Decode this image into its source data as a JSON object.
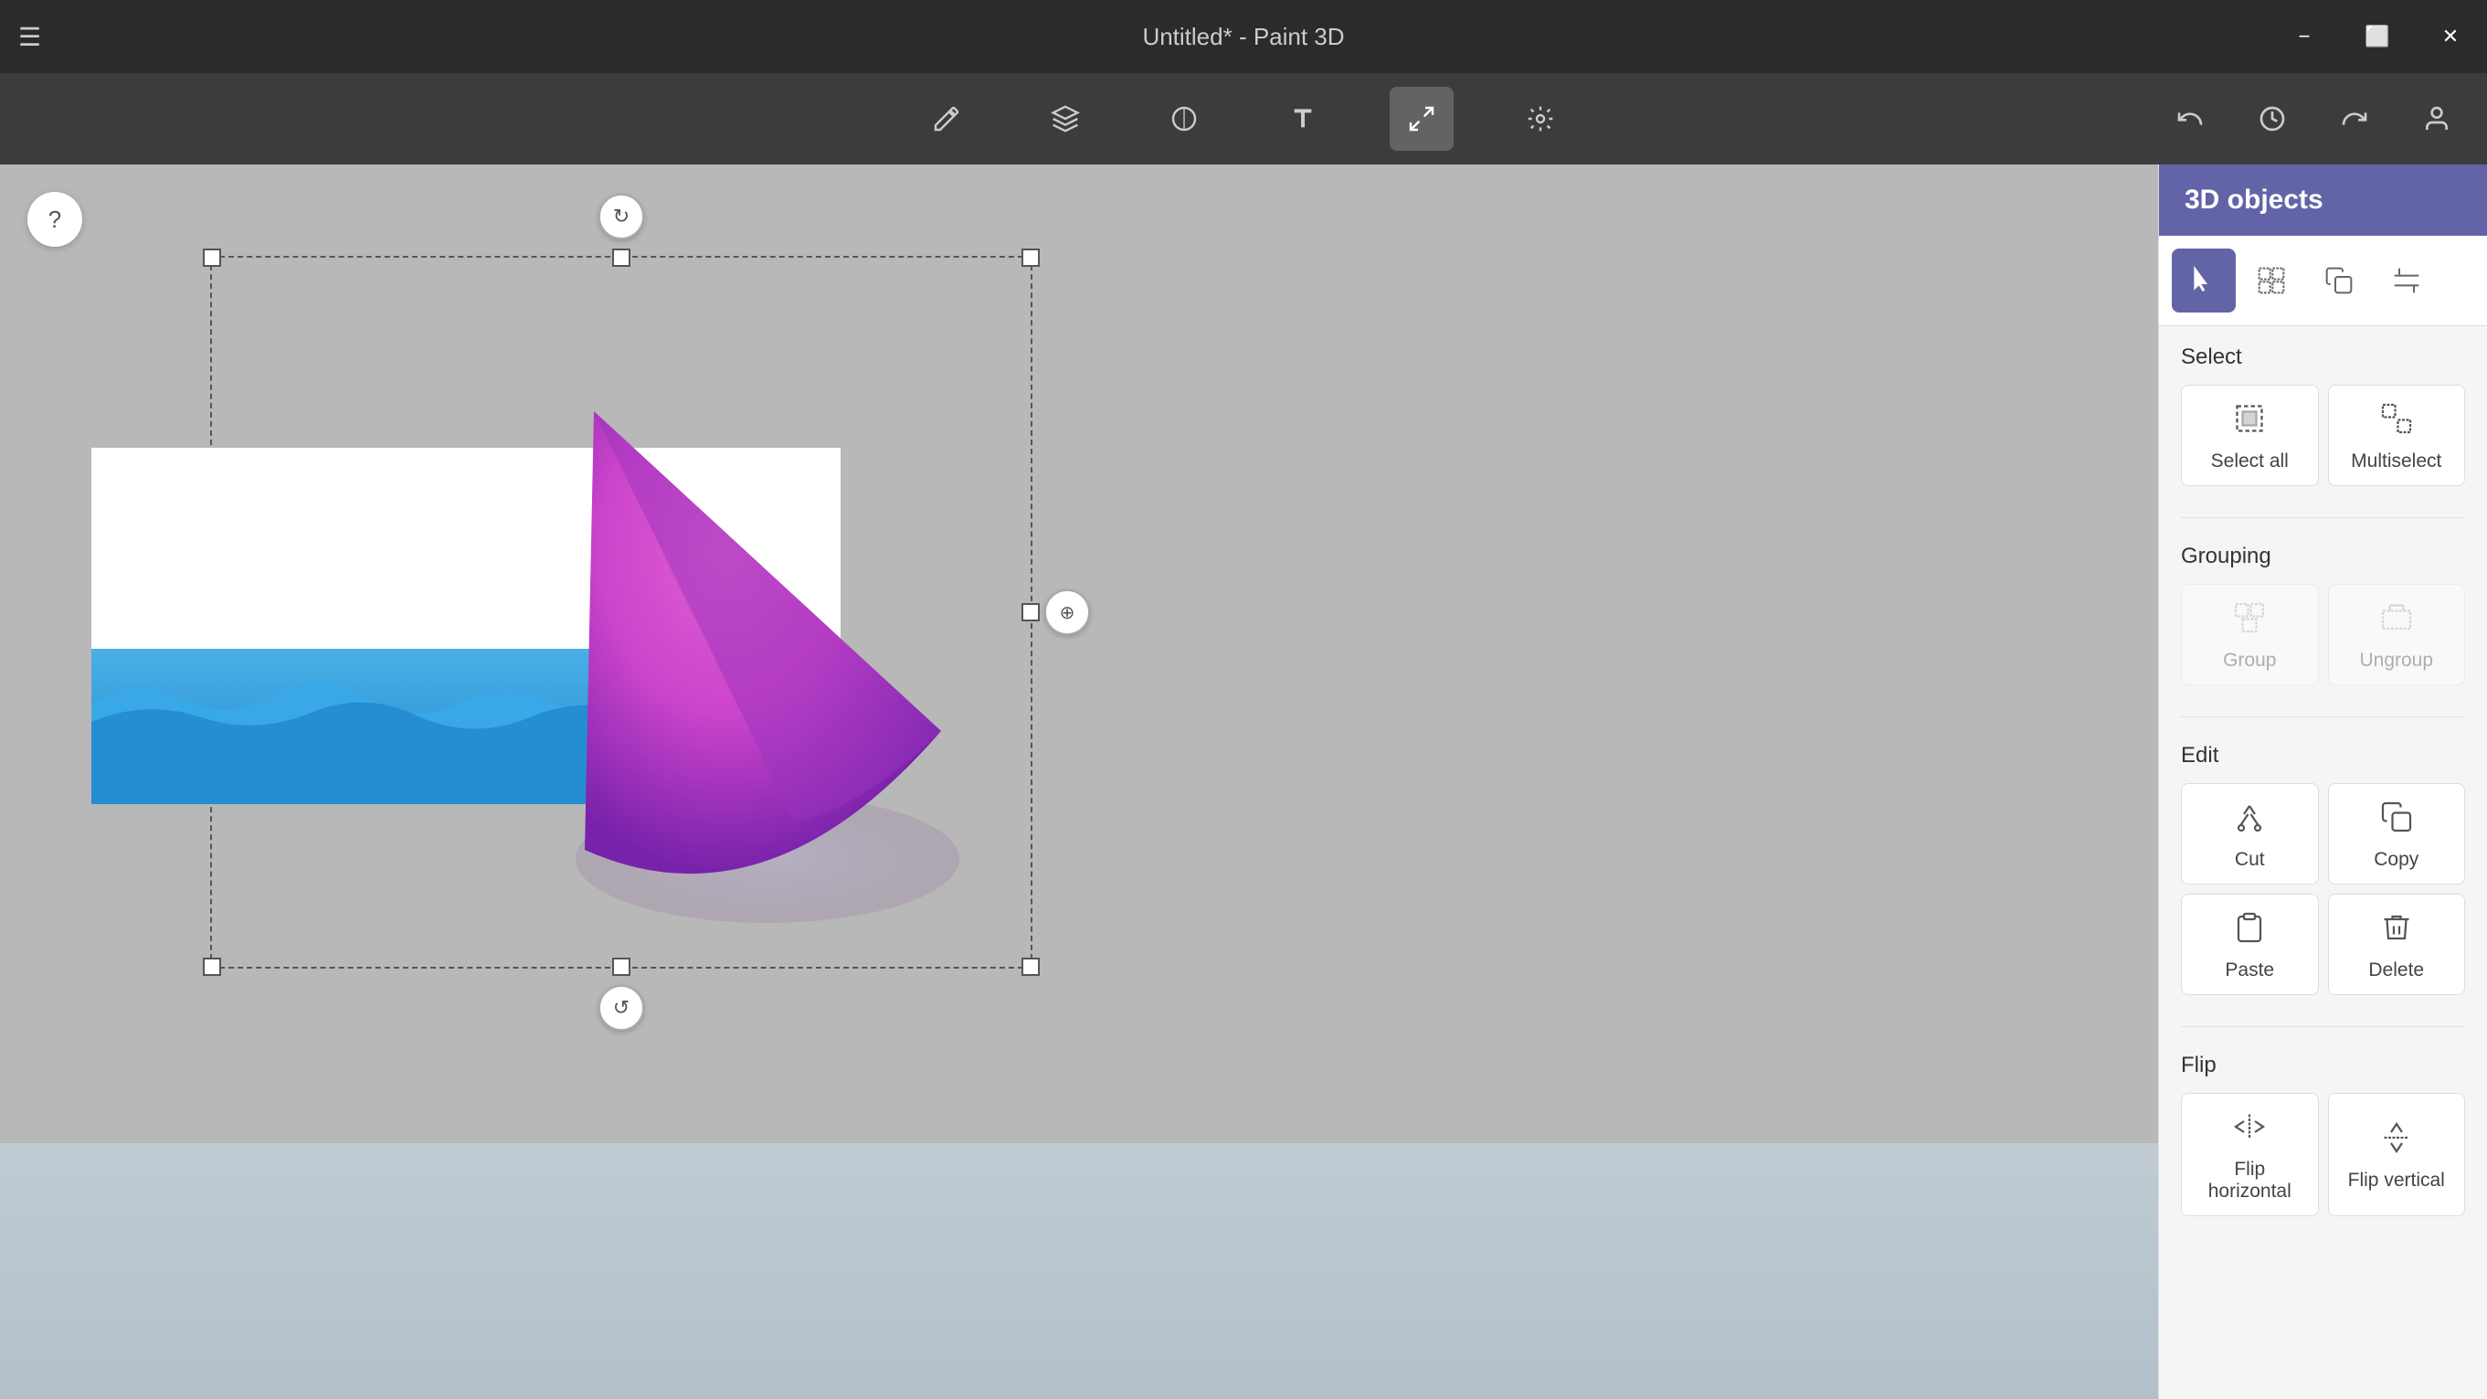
{
  "titlebar": {
    "title": "Untitled* - Paint 3D",
    "minimize_label": "−",
    "maximize_label": "⬜",
    "close_label": "✕"
  },
  "toolbar": {
    "tools": [
      {
        "name": "brushes",
        "icon": "✏️",
        "label": "Brushes"
      },
      {
        "name": "3d-shapes",
        "icon": "⬡",
        "label": "3D shapes"
      },
      {
        "name": "2d-shapes",
        "icon": "⭕",
        "label": "2D shapes"
      },
      {
        "name": "text",
        "icon": "T",
        "label": "Text"
      },
      {
        "name": "canvas",
        "icon": "⤢",
        "label": "Canvas"
      },
      {
        "name": "effects",
        "icon": "✨",
        "label": "Effects"
      }
    ],
    "undo_label": "↩",
    "history_label": "⟳",
    "redo_label": "↪",
    "account_label": "👤"
  },
  "panel": {
    "title": "3D objects",
    "tabs": [
      {
        "name": "select",
        "active": true
      },
      {
        "name": "multiselect-box"
      },
      {
        "name": "copy-object"
      },
      {
        "name": "crop"
      }
    ],
    "sections": {
      "select": {
        "title": "Select",
        "items": [
          {
            "id": "select-all",
            "label": "Select all",
            "enabled": true
          },
          {
            "id": "multiselect",
            "label": "Multiselect",
            "enabled": true
          }
        ]
      },
      "grouping": {
        "title": "Grouping",
        "items": [
          {
            "id": "group",
            "label": "Group",
            "enabled": false
          },
          {
            "id": "ungroup",
            "label": "Ungroup",
            "enabled": false
          }
        ]
      },
      "edit": {
        "title": "Edit",
        "items": [
          {
            "id": "cut",
            "label": "Cut",
            "enabled": true
          },
          {
            "id": "copy",
            "label": "Copy",
            "enabled": true
          },
          {
            "id": "paste",
            "label": "Paste",
            "enabled": true
          },
          {
            "id": "delete",
            "label": "Delete",
            "enabled": true
          }
        ]
      },
      "flip": {
        "title": "Flip",
        "items": [
          {
            "id": "flip-horizontal",
            "label": "Flip horizontal",
            "enabled": true
          },
          {
            "id": "flip-vertical",
            "label": "Flip vertical",
            "enabled": true
          }
        ]
      }
    }
  },
  "canvas": {
    "help_label": "?"
  }
}
